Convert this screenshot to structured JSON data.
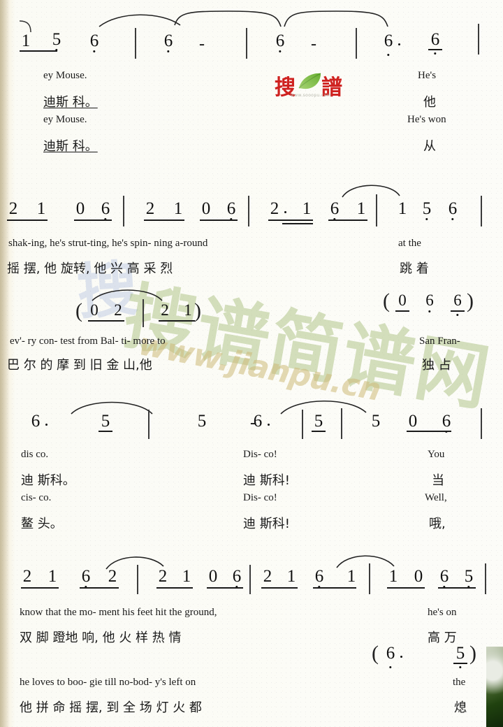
{
  "meta": {
    "notation_type": "jianpu",
    "logo": {
      "chars": [
        "搜",
        "譜"
      ],
      "url_text": "www.sooopu.com",
      "leaf_color": "#6db33f",
      "char_color": "#cf2220"
    },
    "watermarks": {
      "blue_text": "搜",
      "green_text": "搜谱简谱网",
      "url": "www.jianpu.cn"
    }
  },
  "systems": [
    {
      "id": "system-1",
      "measures": [
        {
          "notes": [
            {
              "text": "1",
              "beam": "start",
              "low_dot": false
            },
            {
              "text": "5",
              "beam": "end",
              "low_dot": true
            },
            {
              "text": "6",
              "low_dot": true
            }
          ]
        },
        {
          "notes": [
            {
              "text": "6",
              "low_dot": true
            },
            {
              "text": "-",
              "dash": true
            }
          ]
        },
        {
          "notes": [
            {
              "text": "6",
              "low_dot": true
            },
            {
              "text": "-",
              "dash": true
            }
          ]
        },
        {
          "notes": [
            {
              "text": "6",
              "dur_dot": true,
              "low_dot": true
            },
            {
              "text": "6",
              "beam": "single",
              "low_dot": true
            }
          ]
        }
      ],
      "lyrics": [
        {
          "lang": "en",
          "verse": 1,
          "text": "ey   Mouse."
        },
        {
          "lang": "cn",
          "verse": 1,
          "text": "迪斯 科。"
        },
        {
          "lang": "en",
          "verse": 2,
          "text": "ey   Mouse."
        },
        {
          "lang": "cn",
          "verse": 2,
          "text": "迪斯 科。"
        },
        {
          "lang": "en",
          "verse": 1,
          "text": "He's"
        },
        {
          "lang": "cn",
          "verse": 1,
          "text": "他"
        },
        {
          "lang": "en",
          "verse": 2,
          "text": "He's won"
        },
        {
          "lang": "cn",
          "verse": 2,
          "text": "从"
        }
      ]
    },
    {
      "id": "system-2",
      "measures": [
        {
          "notes": [
            {
              "text": "2",
              "beam": "start"
            },
            {
              "text": "1",
              "beam": "end"
            },
            {
              "text": "0",
              "beam": "start"
            },
            {
              "text": "6",
              "beam": "end",
              "low_dot": true
            }
          ]
        },
        {
          "notes": [
            {
              "text": "2",
              "beam": "start"
            },
            {
              "text": "1",
              "beam": "end"
            },
            {
              "text": "0",
              "beam": "start"
            },
            {
              "text": "6",
              "beam": "end",
              "low_dot": true
            }
          ]
        },
        {
          "notes": [
            {
              "text": "2",
              "beam": "start",
              "dur_dot": true
            },
            {
              "text": "1",
              "beam": "end"
            },
            {
              "text": "6",
              "beam": "start",
              "low_dot": true
            },
            {
              "text": "1",
              "beam": "end"
            }
          ]
        },
        {
          "notes": [
            {
              "text": "1"
            },
            {
              "text": "5",
              "low_dot": true
            },
            {
              "text": "6",
              "low_dot": true
            }
          ]
        }
      ],
      "lyrics": [
        {
          "lang": "en",
          "verse": 1,
          "text": "shak-ing,      he's     strut-ting,      he's      spin- ning  a-round"
        },
        {
          "lang": "cn",
          "verse": 1,
          "text": "摇    摆,    他     旋转,   他    兴  高  采  烈"
        },
        {
          "lang": "en",
          "verse": 1,
          "text": "at     the"
        },
        {
          "lang": "cn",
          "verse": 1,
          "text": "跳   着"
        }
      ]
    },
    {
      "id": "system-3",
      "measures": [
        {
          "parenthesized": true,
          "notes": [
            {
              "text": "0",
              "beam": "start"
            },
            {
              "text": "2",
              "beam": "end"
            }
          ]
        },
        {
          "parenthesized": true,
          "notes": [
            {
              "text": "2",
              "beam": "start"
            },
            {
              "text": "1",
              "beam": "end"
            }
          ]
        },
        {
          "parenthesized": true,
          "notes": [
            {
              "text": "0",
              "beam": "single"
            },
            {
              "text": "6",
              "low_dot": true
            },
            {
              "text": "6",
              "beam": "single",
              "low_dot": true
            }
          ]
        }
      ],
      "lyrics": [
        {
          "lang": "en",
          "verse": 1,
          "text": "ev'- ry        con-          test     from      Bal-  ti- more to"
        },
        {
          "lang": "cn",
          "verse": 1,
          "text": "巴   尔      的        摩     到     旧  金  山,他"
        },
        {
          "lang": "en",
          "verse": 1,
          "text": "San Fran-"
        },
        {
          "lang": "cn",
          "verse": 1,
          "text": "独   占"
        }
      ]
    },
    {
      "id": "system-4",
      "measures": [
        {
          "notes": [
            {
              "text": "6",
              "dur_dot": true
            },
            {
              "text": "5",
              "beam": "single"
            }
          ]
        },
        {
          "notes": [
            {
              "text": "5"
            },
            {
              "text": "-",
              "dash": true
            }
          ]
        },
        {
          "notes": [
            {
              "text": "6",
              "dur_dot": true
            },
            {
              "text": "5",
              "beam": "single"
            }
          ]
        },
        {
          "notes": [
            {
              "text": "5"
            },
            {
              "text": "0",
              "beam": "start"
            },
            {
              "text": "6",
              "beam": "end",
              "low_dot": true
            }
          ]
        }
      ],
      "lyrics": [
        {
          "lang": "en",
          "verse": 1,
          "text": "dis       co."
        },
        {
          "lang": "cn",
          "verse": 1,
          "text": "迪    斯科。"
        },
        {
          "lang": "en",
          "verse": 2,
          "text": "cis-      co."
        },
        {
          "lang": "cn",
          "verse": 2,
          "text": "鳌    头。"
        },
        {
          "lang": "en",
          "verse": 1,
          "text": "Dis-     co!"
        },
        {
          "lang": "cn",
          "verse": 1,
          "text": "迪   斯科!"
        },
        {
          "lang": "en",
          "verse": 2,
          "text": "Dis-     co!"
        },
        {
          "lang": "cn",
          "verse": 2,
          "text": "迪   斯科!"
        },
        {
          "lang": "en",
          "verse": 1,
          "text": "You"
        },
        {
          "lang": "cn",
          "verse": 1,
          "text": "当"
        },
        {
          "lang": "en",
          "verse": 2,
          "text": "Well,"
        },
        {
          "lang": "cn",
          "verse": 2,
          "text": "哦,"
        }
      ]
    },
    {
      "id": "system-5",
      "measures": [
        {
          "notes": [
            {
              "text": "2",
              "beam": "start"
            },
            {
              "text": "1",
              "beam": "end"
            },
            {
              "text": "6",
              "beam": "start",
              "low_dot": true
            },
            {
              "text": "2",
              "beam": "end"
            }
          ]
        },
        {
          "notes": [
            {
              "text": "2",
              "beam": "start"
            },
            {
              "text": "1",
              "beam": "end"
            },
            {
              "text": "0",
              "beam": "start"
            },
            {
              "text": "6",
              "beam": "end",
              "low_dot": true
            }
          ]
        },
        {
          "notes": [
            {
              "text": "2",
              "beam": "start"
            },
            {
              "text": "1",
              "beam": "end"
            },
            {
              "text": "6",
              "beam": "start",
              "low_dot": true
            },
            {
              "text": "1",
              "beam": "end"
            }
          ]
        },
        {
          "notes": [
            {
              "text": "1",
              "beam": "start"
            },
            {
              "text": "0",
              "beam": "end"
            },
            {
              "text": "6",
              "beam": "start",
              "low_dot": true
            },
            {
              "text": "5",
              "beam": "end",
              "low_dot": true
            }
          ]
        }
      ],
      "ossia": {
        "parenthesized": true,
        "notes": [
          {
            "text": "6",
            "dur_dot": true,
            "low_dot": true
          },
          {
            "text": "5",
            "beam": "single",
            "low_dot": true
          }
        ]
      },
      "lyrics": [
        {
          "lang": "en",
          "verse": 1,
          "text": "know that  the mo-        ment      his    feet hit   the ground,"
        },
        {
          "lang": "cn",
          "verse": 1,
          "text": "双   脚  蹬地       响,     他  火  样  热  情"
        },
        {
          "lang": "en",
          "verse": 1,
          "text": "he's  on"
        },
        {
          "lang": "cn",
          "verse": 1,
          "text": "高  万"
        },
        {
          "lang": "en",
          "verse": 2,
          "text": "he   loves  to boo-       gie      till   no-bod- y's  left        on"
        },
        {
          "lang": "cn",
          "verse": 2,
          "text": "他  拼 命 摇      摆,    到  全 场 灯  火    都"
        },
        {
          "lang": "en",
          "verse": 2,
          "text": "the"
        },
        {
          "lang": "cn",
          "verse": 2,
          "text": "熄"
        }
      ]
    }
  ]
}
